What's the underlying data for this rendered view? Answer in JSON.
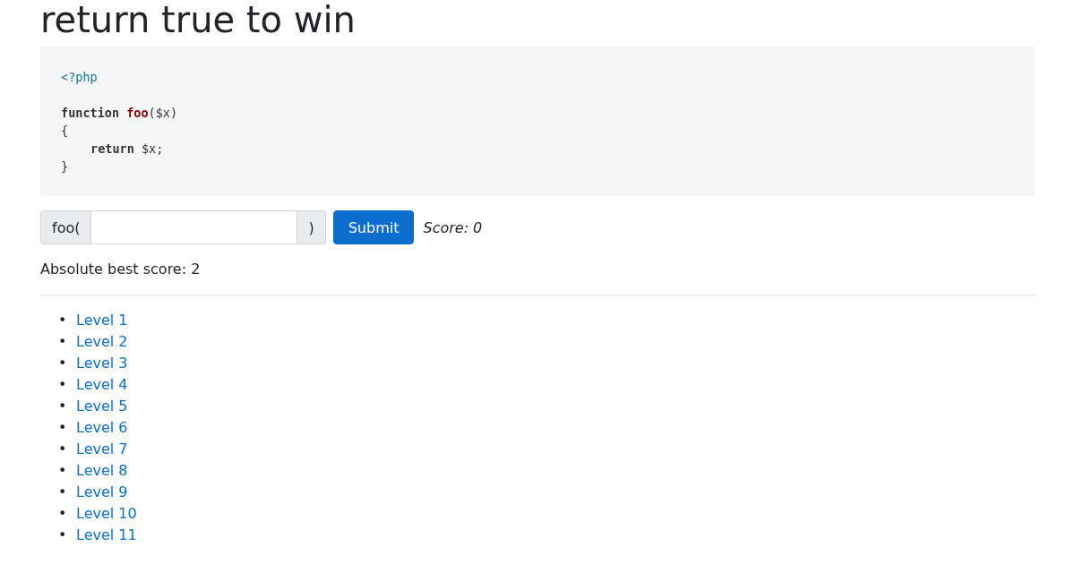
{
  "title": "return true to win",
  "code": {
    "lines": [
      {
        "kind": "code",
        "indented": false,
        "tokens": [
          {
            "kind": "meta",
            "text": "<?php"
          }
        ]
      },
      {
        "kind": "blank"
      },
      {
        "kind": "code",
        "indented": false,
        "tokens": [
          {
            "kind": "keyword",
            "text": "function "
          },
          {
            "kind": "name",
            "text": "foo"
          },
          {
            "kind": "plain",
            "text": "($x)"
          }
        ]
      },
      {
        "kind": "code",
        "indented": false,
        "tokens": [
          {
            "kind": "plain",
            "text": "{"
          }
        ]
      },
      {
        "kind": "code",
        "indented": true,
        "tokens": [
          {
            "kind": "keyword",
            "text": "return "
          },
          {
            "kind": "plain",
            "text": "$x;"
          }
        ]
      },
      {
        "kind": "code",
        "indented": false,
        "tokens": [
          {
            "kind": "plain",
            "text": "}"
          }
        ]
      }
    ]
  },
  "form": {
    "prefix": "foo(",
    "suffix": ")",
    "submit": "Submit",
    "score": "Score: 0"
  },
  "best_score": "Absolute best score: 2",
  "levels": [
    {
      "marker": "•",
      "label": "Level 1"
    },
    {
      "marker": "•",
      "label": "Level 2"
    },
    {
      "marker": "•",
      "label": "Level 3"
    },
    {
      "marker": "•",
      "label": "Level 4"
    },
    {
      "marker": "•",
      "label": "Level 5"
    },
    {
      "marker": "•",
      "label": "Level 6"
    },
    {
      "marker": "•",
      "label": "Level 7"
    },
    {
      "marker": "•",
      "label": "Level 8"
    },
    {
      "marker": "•",
      "label": "Level 9"
    },
    {
      "marker": "•",
      "label": "Level 10"
    },
    {
      "marker": "•",
      "label": "Level 11"
    }
  ]
}
